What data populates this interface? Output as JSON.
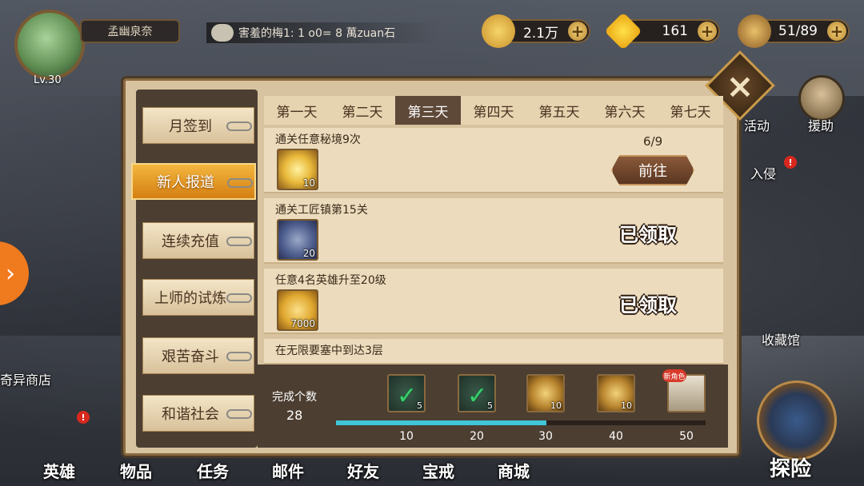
{
  "player": {
    "level": "Lv.30",
    "name": "孟幽泉奈"
  },
  "chat": {
    "message": "害羞的梅1: 1 o0= 8 萬zuan石"
  },
  "resources": {
    "gold": "2.1万",
    "diamonds": "161",
    "stamina": "51/89"
  },
  "side_buttons": {
    "activity": "活动",
    "assist": "援助",
    "invasion": "入侵",
    "collection": "收藏馆",
    "shop": "奇异商店"
  },
  "menu": [
    {
      "label": "月签到"
    },
    {
      "label": "新人报道",
      "active": true
    },
    {
      "label": "连续充值"
    },
    {
      "label": "上师的试炼"
    },
    {
      "label": "艰苦奋斗"
    },
    {
      "label": "和谐社会"
    }
  ],
  "tabs": [
    "第一天",
    "第二天",
    "第三天",
    "第四天",
    "第五天",
    "第六天",
    "第七天"
  ],
  "active_tab": 2,
  "quests": [
    {
      "title": "通关任意秘境9次",
      "item_count": "10",
      "progress": "6/9",
      "action": "前往",
      "icon": "gem-orb-icon",
      "color": "#e8b83a"
    },
    {
      "title": "通关工匠镇第15关",
      "item_count": "20",
      "status": "已领取",
      "icon": "anvil-icon",
      "color": "#4a5a8a"
    },
    {
      "title": "任意4名英雄升至20级",
      "item_count": "7000",
      "status": "已领取",
      "icon": "gold-coin-icon",
      "color": "#e0a830"
    },
    {
      "title": "在无限要塞中到达3层"
    }
  ],
  "completion": {
    "label": "完成个数",
    "value": "28",
    "progress": 0.57,
    "max": 50,
    "milestones": [
      {
        "at": "10",
        "count": "5",
        "claimed": true,
        "icon": "green-potion-icon"
      },
      {
        "at": "20",
        "count": "5",
        "claimed": true,
        "icon": "green-potion-icon"
      },
      {
        "at": "30",
        "count": "10",
        "claimed": false,
        "icon": "gold-potion-icon"
      },
      {
        "at": "40",
        "count": "10",
        "claimed": false,
        "icon": "gold-potion-icon"
      },
      {
        "at": "50",
        "count": "",
        "claimed": false,
        "icon": "hero-card-icon",
        "tag": "新角色"
      }
    ]
  },
  "nav": [
    "英雄",
    "物品",
    "任务",
    "邮件",
    "好友",
    "宝戒",
    "商城"
  ],
  "explore_label": "探险"
}
